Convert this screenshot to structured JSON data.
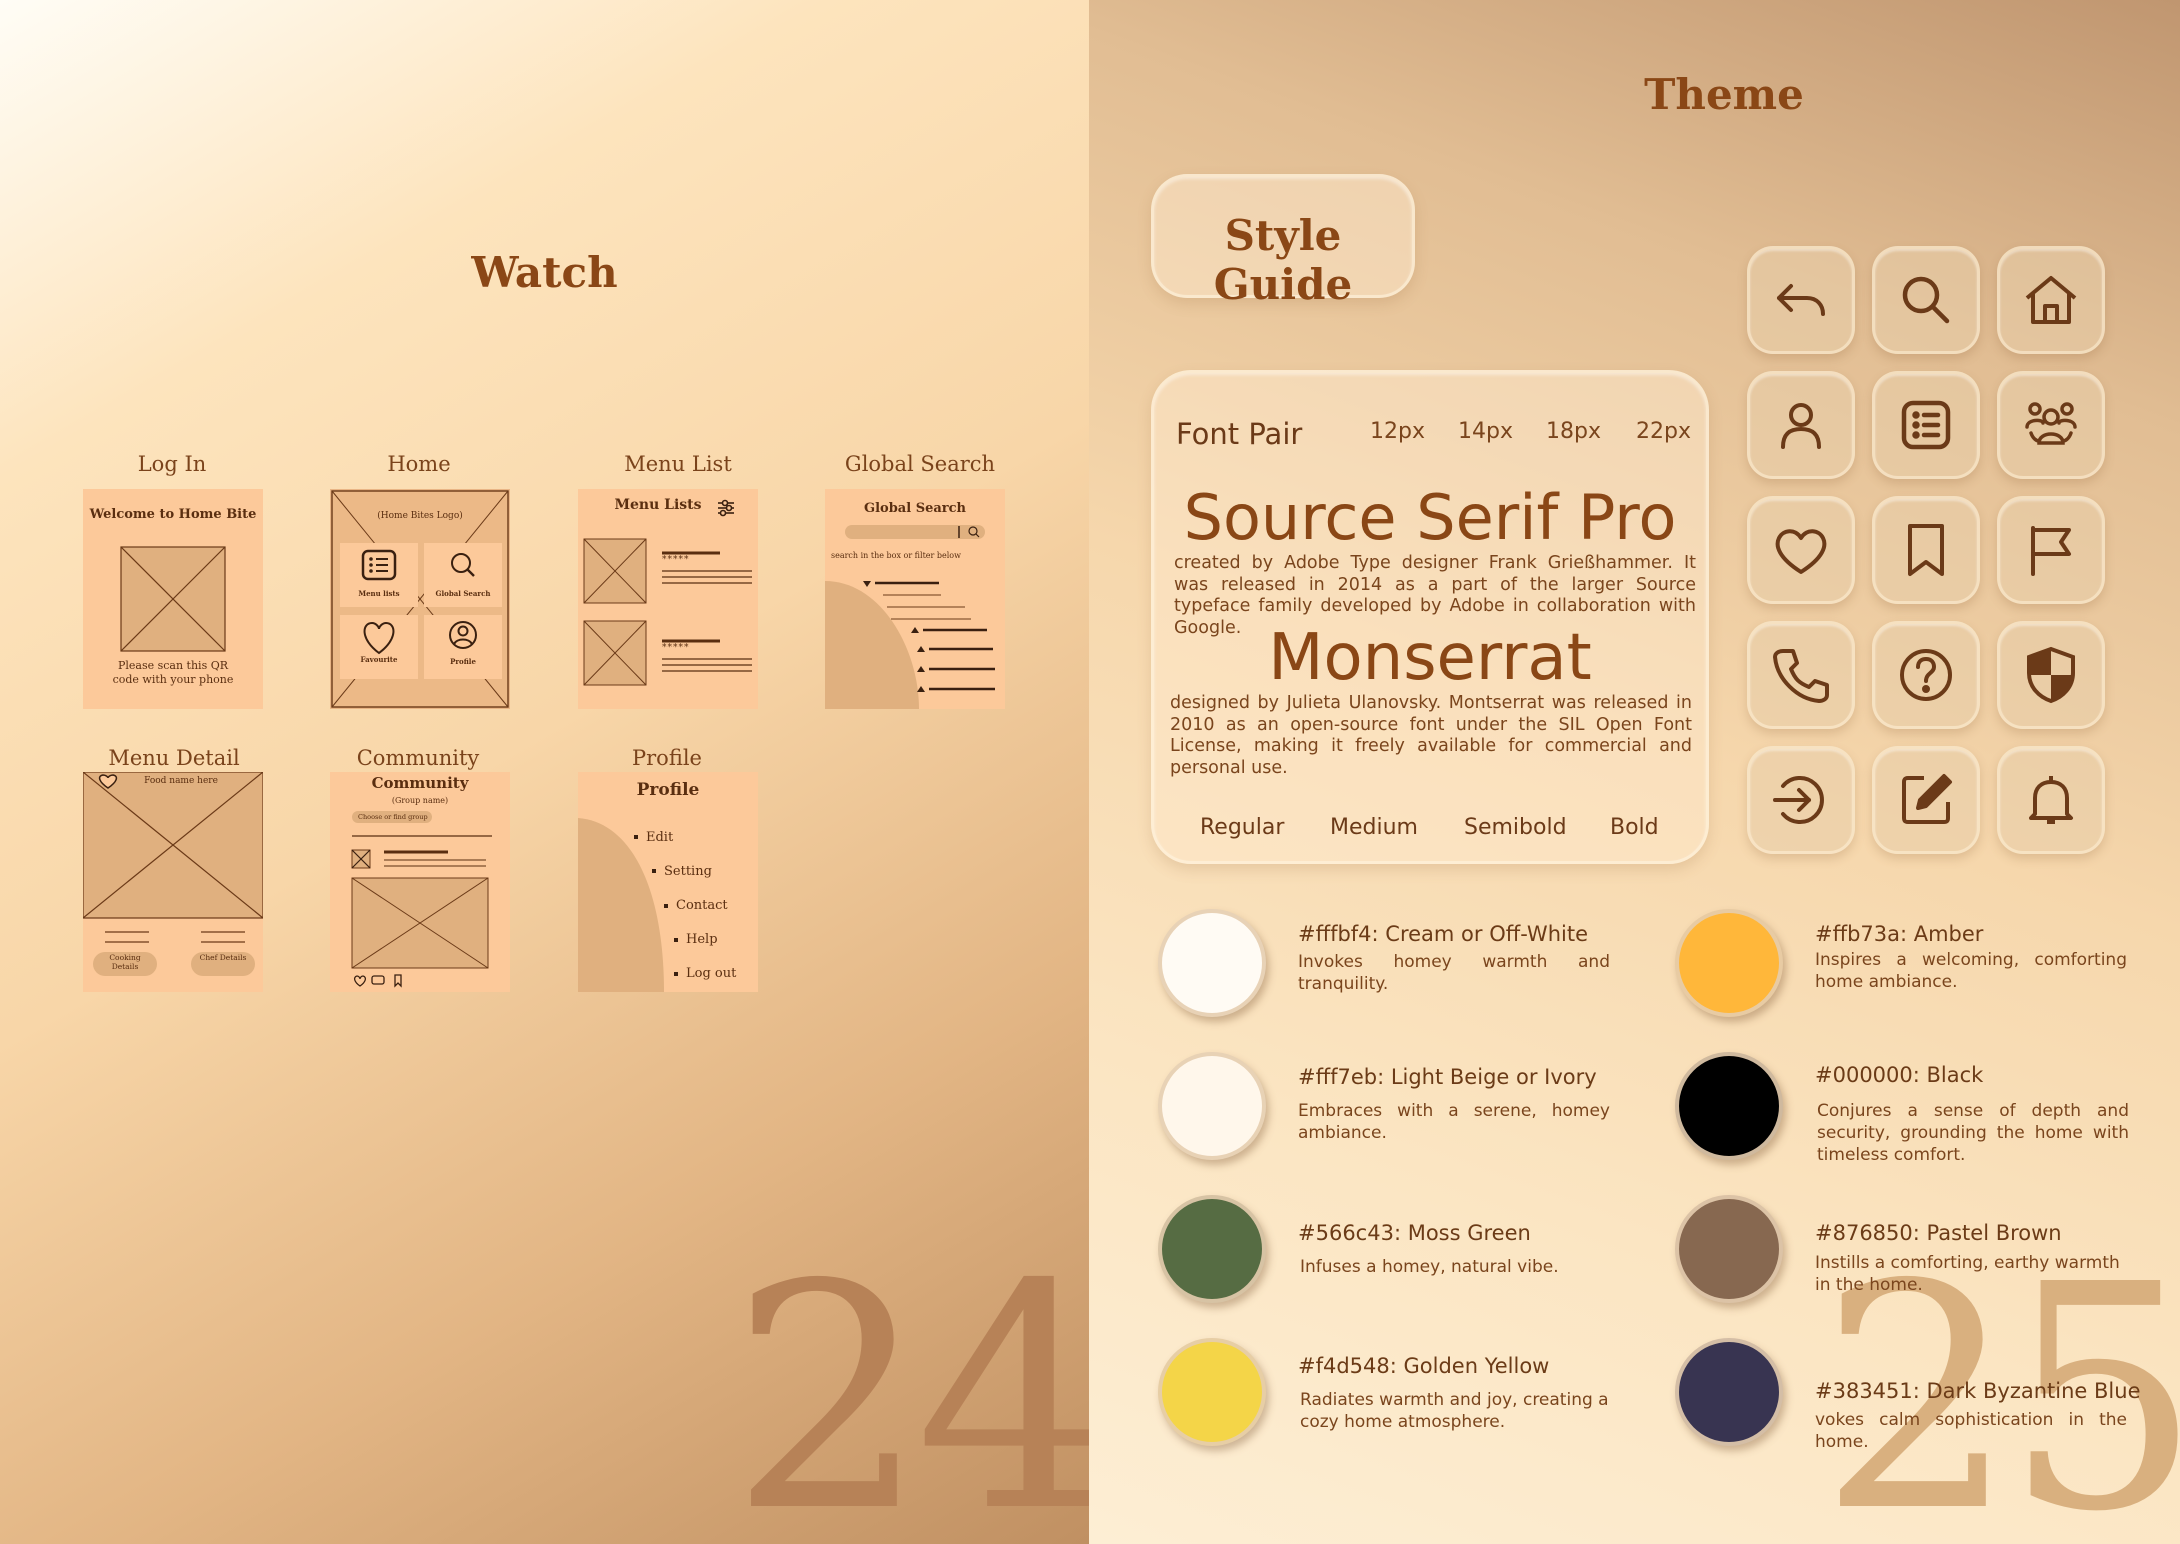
{
  "left": {
    "title": "Watch",
    "page_number": "24",
    "screens": [
      {
        "label": "Log In",
        "heading": "Welcome to Home Bite",
        "note": "Please scan this QR code with your phone"
      },
      {
        "label": "Home",
        "logo": "(Home Bites Logo)",
        "tiles": [
          "Menu lists",
          "Global Search",
          "Favourite",
          "Profile"
        ]
      },
      {
        "label": "Menu List",
        "heading": "Menu Lists",
        "stars": "*****"
      },
      {
        "label": "Global Search",
        "heading": "Global Search",
        "hint": "search in the box or filter below"
      },
      {
        "label": "Menu Detail",
        "food": "Food name here",
        "buttons": [
          "Cooking Details",
          "Chef Details"
        ]
      },
      {
        "label": "Community",
        "heading": "Community",
        "group": "(Group name)",
        "chip": "Choose or find group"
      },
      {
        "label": "Profile",
        "heading": "Profile",
        "menu": [
          "Edit",
          "Setting",
          "Contact",
          "Help",
          "Log out"
        ]
      }
    ]
  },
  "right": {
    "title": "Theme",
    "page_number": "25",
    "style_guide_label": "Style Guide",
    "font_pair": {
      "label": "Font Pair",
      "sizes": [
        "12px",
        "14px",
        "18px",
        "22px"
      ],
      "font1_name": "Source Serif Pro",
      "font1_desc": "created by Adobe Type designer Frank Grießhammer. It was released in 2014 as a part of the larger Source typeface family developed by Adobe in collaboration with Google.",
      "font2_name": "Monserrat",
      "font2_desc": "designed by Julieta Ulanovsky. Montserrat was released in 2010 as an open-source font under the SIL Open Font License, making it freely available for commercial and personal use.",
      "weights": [
        "Regular",
        "Medium",
        "Semibold",
        "Bold"
      ]
    },
    "icons": [
      "undo-icon",
      "search-icon",
      "home-icon",
      "user-icon",
      "list-icon",
      "community-icon",
      "heart-icon",
      "bookmark-icon",
      "flag-icon",
      "phone-icon",
      "help-icon",
      "shield-icon",
      "login-icon",
      "edit-icon",
      "bell-icon"
    ],
    "colors": [
      {
        "hex": "#fffbf4",
        "title": "#fffbf4: Cream or Off-White",
        "desc": "Invokes homey warmth and tranquility."
      },
      {
        "hex": "#ffb73a",
        "title": "#ffb73a: Amber",
        "desc": "Inspires a welcoming, comforting home ambiance."
      },
      {
        "hex": "#fff7eb",
        "title": "#fff7eb: Light Beige or Ivory",
        "desc": "Embraces with a serene, homey ambiance."
      },
      {
        "hex": "#000000",
        "title": "#000000: Black",
        "desc": "Conjures a sense of depth and security, grounding the home with timeless comfort."
      },
      {
        "hex": "#566c43",
        "title": "#566c43: Moss Green",
        "desc": "Infuses a homey, natural vibe."
      },
      {
        "hex": "#876850",
        "title": "#876850: Pastel Brown",
        "desc": "Instills a comforting, earthy warmth in the home."
      },
      {
        "hex": "#f4d548",
        "title": "#f4d548: Golden Yellow",
        "desc": "Radiates warmth and joy, creating a cozy home atmosphere."
      },
      {
        "hex": "#383451",
        "title": "#383451: Dark Byzantine Blue",
        "desc": "vokes calm sophistication in the home."
      }
    ]
  }
}
